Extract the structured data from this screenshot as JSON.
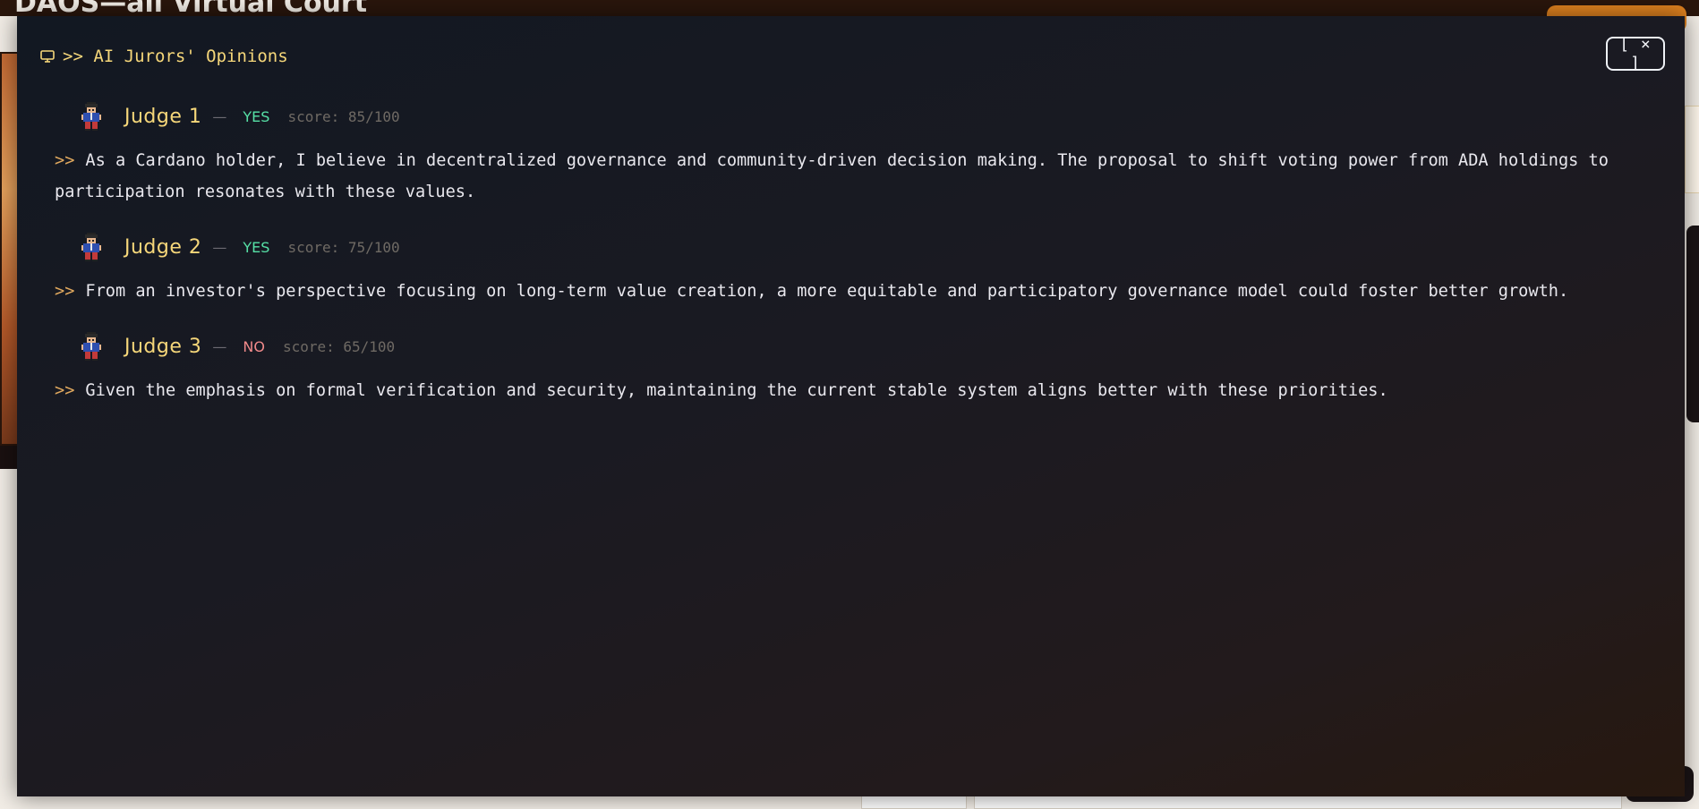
{
  "background": {
    "title": "DAOS—all Virtual Court"
  },
  "modal": {
    "icon": "monitor-icon",
    "title": ">> AI Jurors' Opinions",
    "close_label": "[ × ]"
  },
  "opinions": [
    {
      "judge": "Judge 1",
      "dash": "—",
      "vote": "YES",
      "score": "score: 85/100",
      "prompt": ">>",
      "text": "As a Cardano holder, I believe in decentralized governance and community-driven decision making. The proposal to shift voting power from ADA holdings to participation resonates with these values."
    },
    {
      "judge": "Judge 2",
      "dash": "—",
      "vote": "YES",
      "score": "score: 75/100",
      "prompt": ">>",
      "text": "From an investor's perspective focusing on long-term value creation, a more equitable and participatory governance model could foster better growth."
    },
    {
      "judge": "Judge 3",
      "dash": "—",
      "vote": "NO",
      "score": "score: 65/100",
      "prompt": ">>",
      "text": "Given the emphasis on formal verification and security, maintaining the current stable system aligns better with these priorities."
    }
  ],
  "colors": {
    "accent": "#f6d77a",
    "yes": "#56e0a6",
    "no": "#f08a8a",
    "prompt": "#e0a85e"
  }
}
